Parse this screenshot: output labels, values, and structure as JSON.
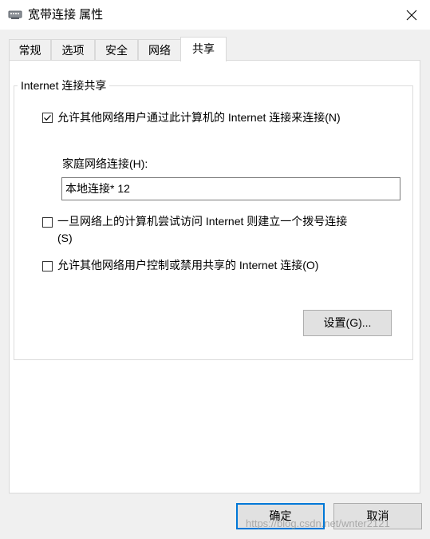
{
  "window": {
    "title": "宽带连接 属性",
    "icon": "network-connection-icon",
    "close_icon": "close-icon"
  },
  "tabs": [
    {
      "label": "常规",
      "active": false
    },
    {
      "label": "选项",
      "active": false
    },
    {
      "label": "安全",
      "active": false
    },
    {
      "label": "网络",
      "active": false
    },
    {
      "label": "共享",
      "active": true
    }
  ],
  "sharing": {
    "group_title": "Internet 连接共享",
    "allow_sharing": {
      "label": "允许其他网络用户通过此计算机的 Internet 连接来连接(N)",
      "checked": true
    },
    "home_network_label": "家庭网络连接(H):",
    "home_network_value": "本地连接* 12",
    "dial_on_demand": {
      "label_line1": "一旦网络上的计算机尝试访问 Internet 则建立一个拨号连接",
      "label_line2": "(S)",
      "checked": false
    },
    "allow_control": {
      "label": "允许其他网络用户控制或禁用共享的 Internet 连接(O)",
      "checked": false
    },
    "settings_button": "设置(G)..."
  },
  "footer": {
    "ok_button": "确定",
    "cancel_button": "取消"
  },
  "watermark": "https://blog.csdn.net/wnter2121",
  "colors": {
    "accent": "#0078d7",
    "dialog_bg": "#f0f0f0",
    "panel_bg": "#ffffff"
  }
}
